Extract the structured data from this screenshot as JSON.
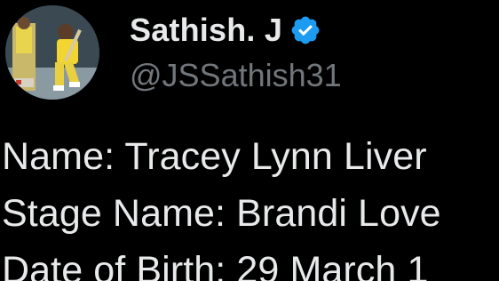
{
  "author": {
    "display_name": "Sathish. J",
    "handle": "@JSSathish31",
    "verified_color": "#1d9bf0",
    "avatar_icon": "profile-photo-cricketer"
  },
  "tweet": {
    "lines": [
      "Name: Tracey Lynn Liver",
      "Stage Name: Brandi Love",
      "Date of Birth: 29 March 1"
    ]
  },
  "colors": {
    "background": "#000000",
    "text": "#e7e9ea",
    "secondary": "#71767b"
  }
}
